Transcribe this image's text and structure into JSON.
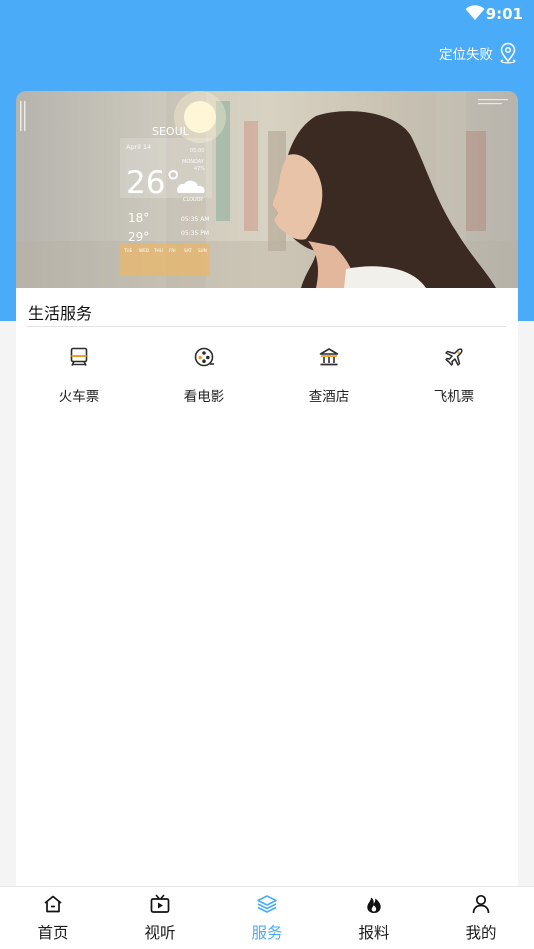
{
  "status_bar": {
    "time": "9:01"
  },
  "header": {
    "location_text": "定位失败"
  },
  "banner": {
    "city": "SEOUL",
    "date": "April 14",
    "day": "MONDAY",
    "clock": "05:00",
    "humidity": "47%",
    "temperature": "26°",
    "condition": "CLOUDY",
    "low": "18°",
    "high": "29°",
    "sunrise": "05:35 AM",
    "sunset": "05:35 PM",
    "days": [
      "TUE",
      "WED",
      "THU",
      "FRI",
      "SAT",
      "SUN"
    ]
  },
  "services": {
    "title": "生活服务",
    "items": [
      {
        "label": "火车票",
        "icon": "train-icon"
      },
      {
        "label": "看电影",
        "icon": "film-reel-icon"
      },
      {
        "label": "查酒店",
        "icon": "hotel-icon"
      },
      {
        "label": "飞机票",
        "icon": "airplane-icon"
      }
    ]
  },
  "bottom_nav": {
    "active": "服务",
    "items": [
      {
        "label": "首页",
        "icon": "home-icon"
      },
      {
        "label": "视听",
        "icon": "tv-play-icon"
      },
      {
        "label": "服务",
        "icon": "layers-icon"
      },
      {
        "label": "报料",
        "icon": "flame-icon"
      },
      {
        "label": "我的",
        "icon": "user-icon"
      }
    ]
  },
  "colors": {
    "primary": "#4aacf8",
    "service_icon_accent": "#f0a020"
  }
}
